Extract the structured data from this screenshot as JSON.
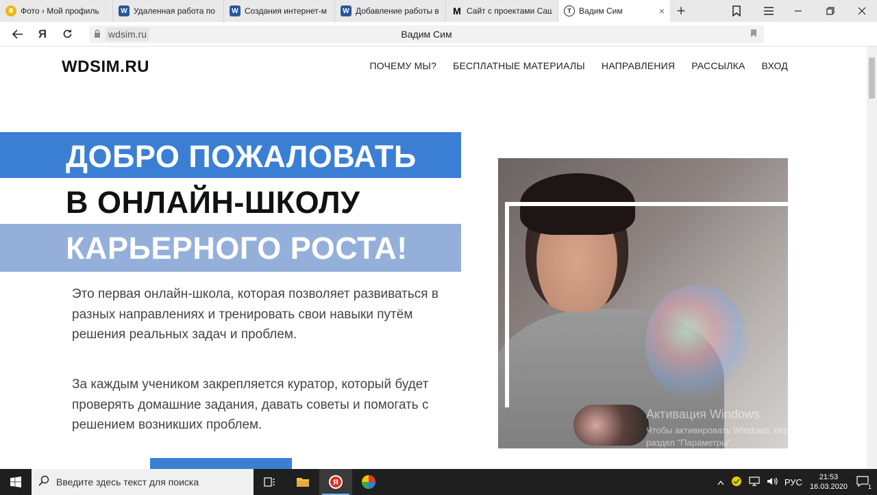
{
  "browser": {
    "tabs": [
      {
        "label": "Фото › Мой профиль",
        "icon": "coin-icon",
        "color": "#f2b400"
      },
      {
        "label": "Удаленная работа по",
        "icon": "word-doc-icon",
        "color": "#2b579a"
      },
      {
        "label": "Создания интернет-м",
        "icon": "word-doc-icon",
        "color": "#2b579a"
      },
      {
        "label": "Добавление работы в",
        "icon": "word-doc-icon",
        "color": "#2b579a"
      },
      {
        "label": "Сайт с проектами Саш",
        "icon": "m-logo-icon",
        "color": "#000000"
      },
      {
        "label": "Вадим Сим",
        "icon": "site-icon",
        "color": "#ffffff"
      }
    ],
    "tab_icon_letters": [
      "₴",
      "W",
      "W",
      "W",
      "M",
      "Т"
    ],
    "close_glyph": "×",
    "add_glyph": "+",
    "url_domain": "wdsim.ru",
    "page_title": "Вадим Сим",
    "yandex_glyph": "Я"
  },
  "site": {
    "logo": "WDSIM.RU",
    "nav": [
      "ПОЧЕМУ МЫ?",
      "БЕСПЛАТНЫЕ МАТЕРИАЛЫ",
      "НАПРАВЛЕНИЯ",
      "РАССЫЛКА",
      "ВХОД"
    ],
    "hero_lines": [
      "ДОБРО ПОЖАЛОВАТЬ",
      "В ОНЛАЙН-ШКОЛУ",
      "КАРЬЕРНОГО РОСТА!"
    ],
    "paragraphs": [
      "Это первая онлайн-школа, которая позволяет развиваться в разных направлениях и тренировать свои навыки путём решения реальных задач и проблем.",
      "За каждым учеником закрепляется куратор, который будет проверять домашние задания, давать советы и помогать с решением возникших проблем."
    ],
    "accent_color": "#3b7fd5",
    "light_accent_color": "#94b0da"
  },
  "watermark": {
    "title": "Активация Windows",
    "text": "Чтобы активировать Windows, перейдите в раздел \"Параметры\"."
  },
  "taskbar": {
    "search_placeholder": "Введите здесь текст для поиска",
    "lang": "РУС",
    "time": "21:53",
    "date": "16.03.2020",
    "notification_count": "1"
  }
}
